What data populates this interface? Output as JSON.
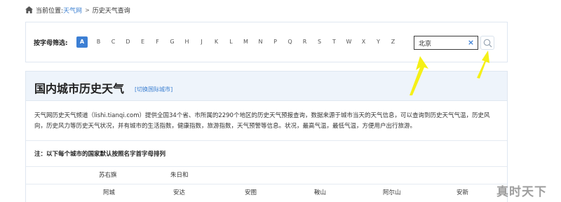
{
  "breadcrumb": {
    "prefix": "当前位置:",
    "site": "天气网",
    "separator": ">",
    "current": "历史天气查询"
  },
  "filter": {
    "label": "按字母筛选:",
    "letters": [
      "A",
      "B",
      "C",
      "D",
      "E",
      "F",
      "G",
      "H",
      "J",
      "K",
      "L",
      "M",
      "N",
      "P",
      "Q",
      "R",
      "S",
      "T",
      "W",
      "X",
      "Y",
      "Z"
    ],
    "active_letter": "A"
  },
  "search": {
    "value": "北京",
    "clear_icon": "close-icon",
    "search_icon": "search-icon"
  },
  "main": {
    "title": "国内城市历史天气",
    "intl_link": "[切换国际城市]",
    "description": "天气网历史天气频道（lishi.tianqi.com）提供全国34个省、市所属的2290个地区的历史天气预报查询，数据来源于城市当天的天气信息，可以查询到历史天气气温，历史风向，历史风力等历史天气状况，并有城市的生活指数，健康指数，旅游指数，天气预警等信息。状况，最高气温，最低气温，方便用户出行旅游。",
    "note": "注：以下每个城市的国家默认按照名字首字母排列"
  },
  "table": {
    "row1": [
      "苏右旗",
      "朱日和"
    ],
    "row2": [
      "阿城",
      "安达",
      "安图",
      "鞍山",
      "阿尔山",
      "安新"
    ]
  },
  "watermark": "真时天下",
  "colors": {
    "accent": "#3c7fd4",
    "link": "#3b7fd1",
    "header_band": "#eef4fb",
    "annotation_arrow": "#f5f016"
  }
}
